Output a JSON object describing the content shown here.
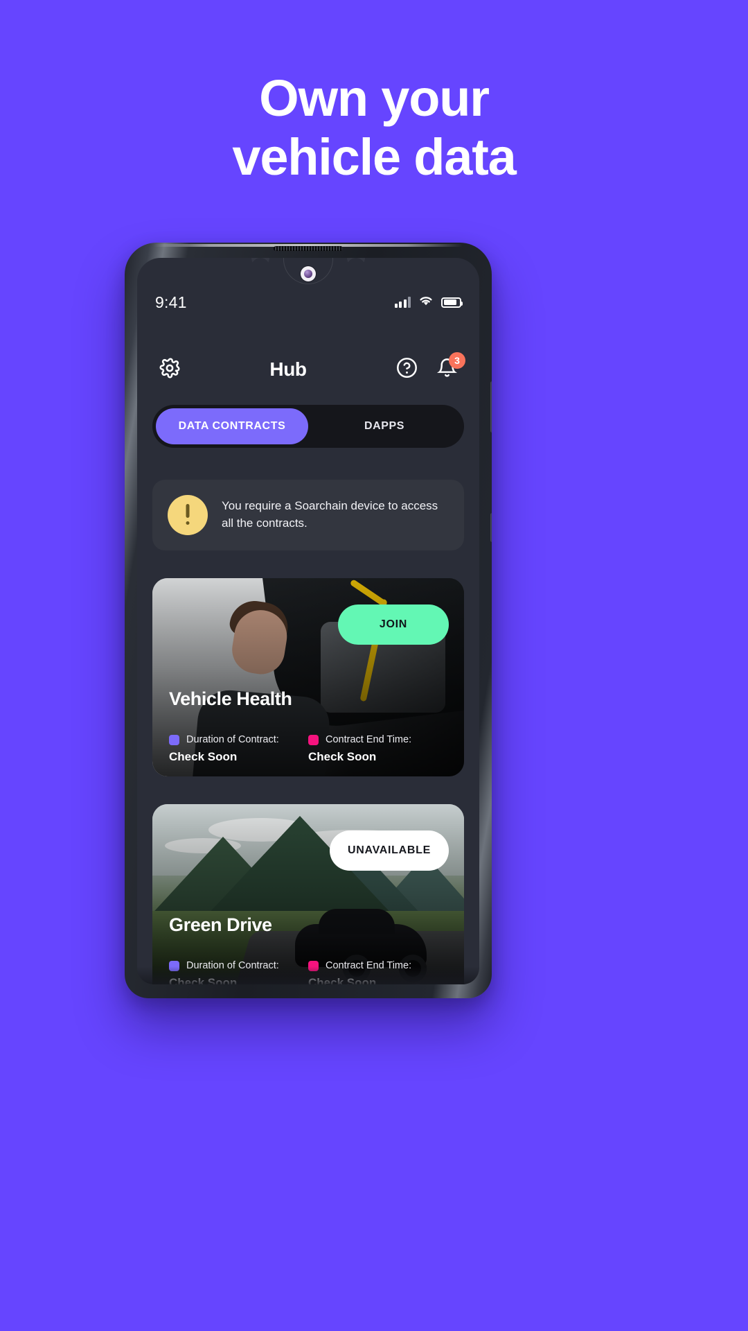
{
  "page": {
    "background_color": "#6645FF",
    "headline_line1": "Own your",
    "headline_line2": "vehicle data"
  },
  "phone": {
    "status_bar": {
      "time": "9:41",
      "signal_icon": "cellular-signal-icon",
      "wifi_icon": "wifi-icon",
      "battery_icon": "battery-icon"
    },
    "app_header": {
      "settings_icon": "gear-icon",
      "title": "Hub",
      "help_icon": "help-circle-icon",
      "notifications_icon": "bell-icon",
      "notifications_badge": "3",
      "badge_color": "#F9735B"
    },
    "tabs": {
      "active_color": "#7C6BFB",
      "items": [
        {
          "label": "DATA CONTRACTS",
          "active": true
        },
        {
          "label": "DAPPS",
          "active": false
        }
      ]
    },
    "notice": {
      "icon": "warning-exclamation-icon",
      "icon_color": "#F5D77C",
      "text": "You require a Soarchain device to access all the contracts."
    },
    "contracts": [
      {
        "title": "Vehicle Health",
        "cta_label": "JOIN",
        "cta_style": "join",
        "cta_color": "#63F7B4",
        "image": "mechanic-engine-bay-photo",
        "meta": [
          {
            "dot_color": "#7C6BFB",
            "label": "Duration of Contract:",
            "value": "Check Soon"
          },
          {
            "dot_color": "#F5137E",
            "label": "Contract End Time:",
            "value": "Check Soon"
          }
        ]
      },
      {
        "title": "Green Drive",
        "cta_label": "UNAVAILABLE",
        "cta_style": "unavailable",
        "cta_color": "#FFFFFF",
        "image": "mountain-valley-road-car-photo",
        "meta": [
          {
            "dot_color": "#7C6BFB",
            "label": "Duration of Contract:",
            "value": "Check Soon"
          },
          {
            "dot_color": "#F5137E",
            "label": "Contract End Time:",
            "value": "Check Soon"
          }
        ]
      }
    ]
  }
}
